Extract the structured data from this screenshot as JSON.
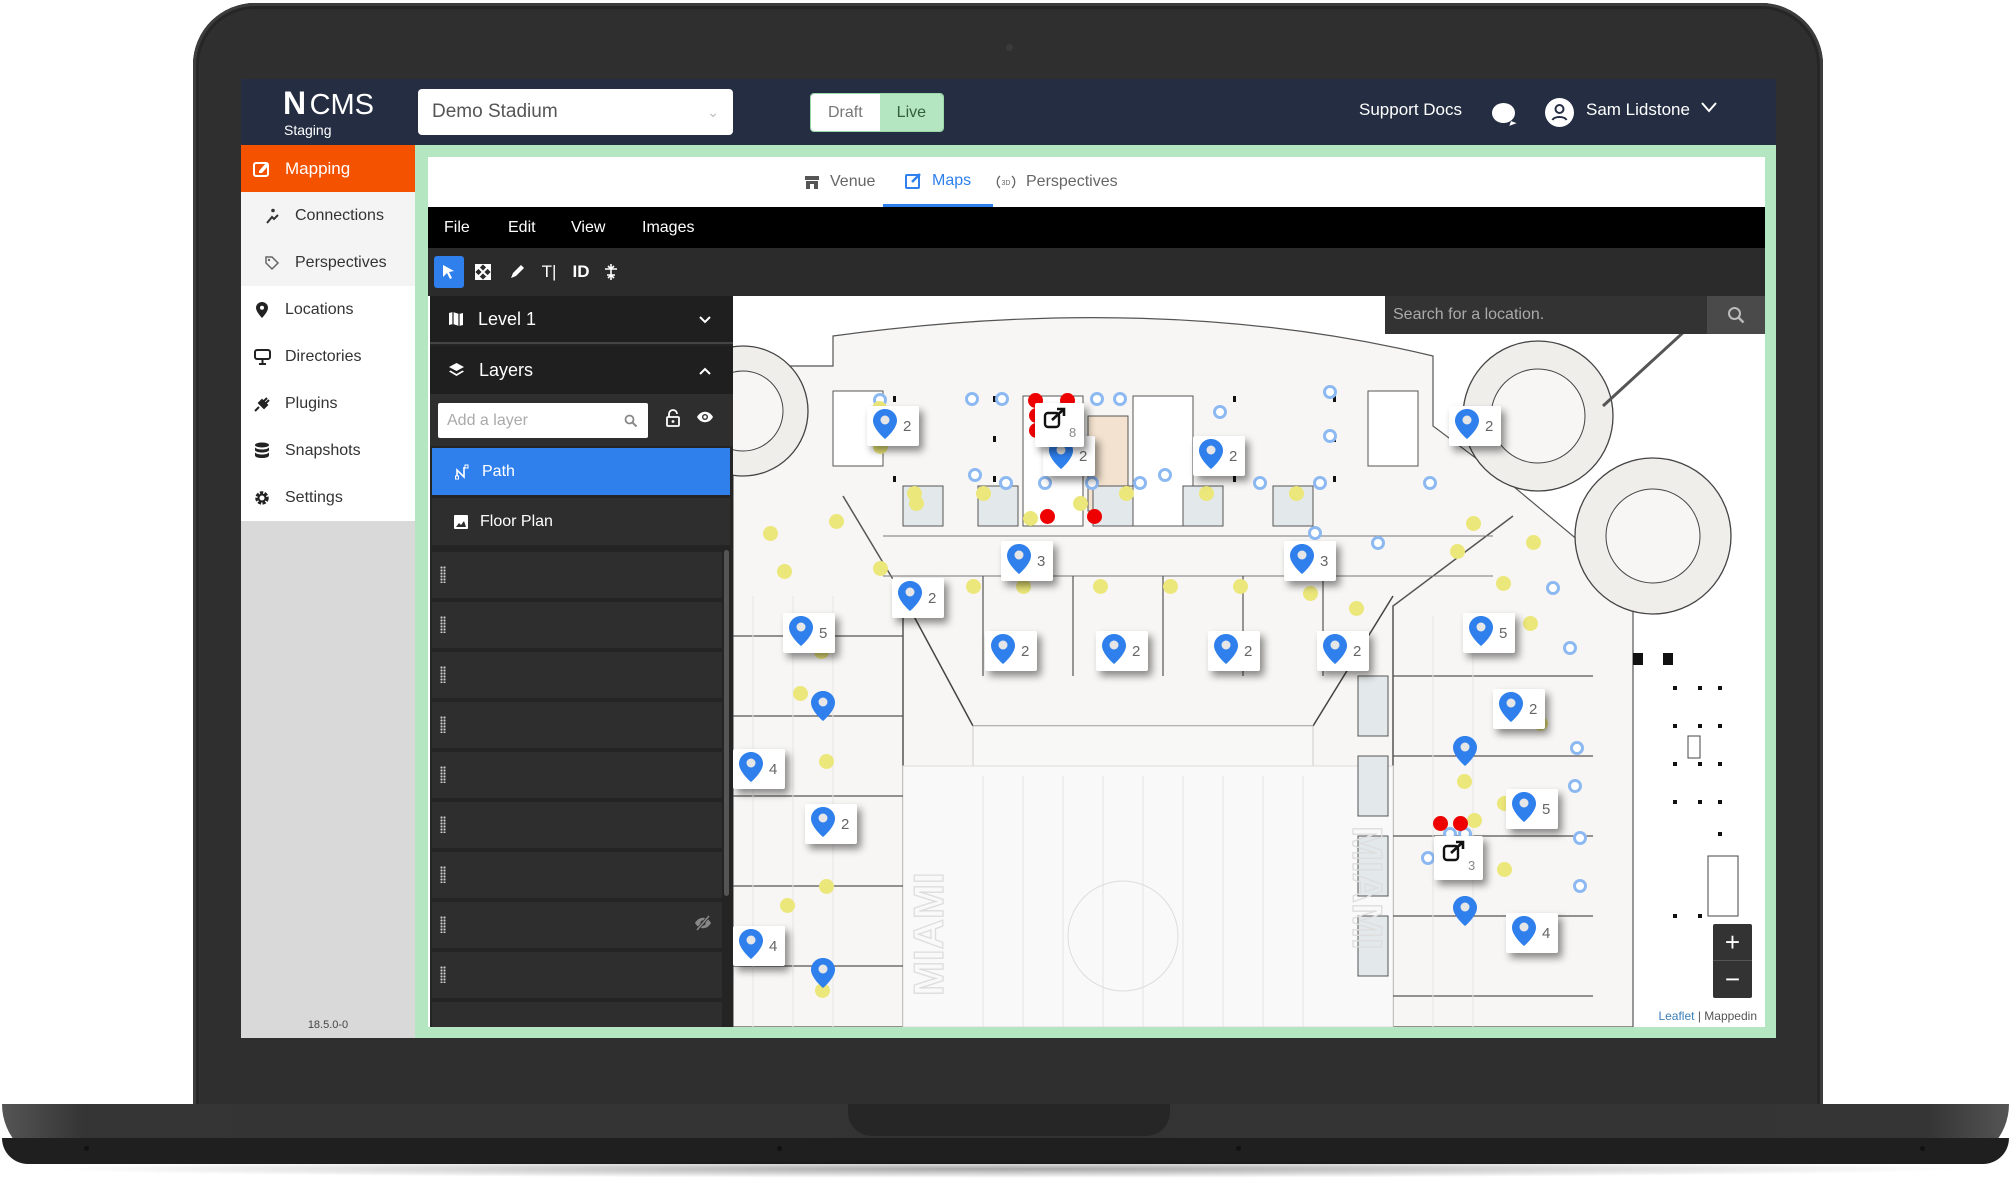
{
  "header": {
    "logo_mark": "N",
    "logo_text": "CMS",
    "environment": "Staging",
    "venue_select": {
      "value": "Demo Stadium"
    },
    "mode_toggle": {
      "options": [
        "Draft",
        "Live"
      ],
      "selected": "Live"
    },
    "support_link": "Support Docs",
    "user_name": "Sam Lidstone"
  },
  "sidebar": {
    "items": [
      {
        "label": "Mapping",
        "icon": "mapping-edit-icon",
        "active": true
      },
      {
        "label": "Connections",
        "icon": "escalator-icon",
        "sub": true
      },
      {
        "label": "Perspectives",
        "icon": "tag-icon",
        "sub": true
      },
      {
        "label": "Locations",
        "icon": "map-pin-icon"
      },
      {
        "label": "Directories",
        "icon": "kiosk-icon"
      },
      {
        "label": "Plugins",
        "icon": "plug-icon"
      },
      {
        "label": "Snapshots",
        "icon": "database-icon"
      },
      {
        "label": "Settings",
        "icon": "gear-icon"
      }
    ],
    "version": "18.5.0-0"
  },
  "tabs": [
    {
      "label": "Venue",
      "icon": "store-icon"
    },
    {
      "label": "Maps",
      "icon": "edit-icon",
      "active": true
    },
    {
      "label": "Perspectives",
      "icon": "3d-rotate-icon"
    }
  ],
  "menubar": [
    "File",
    "Edit",
    "View",
    "Images"
  ],
  "toolbar": [
    {
      "name": "select-tool",
      "glyph": "",
      "active": true
    },
    {
      "name": "expand-tool",
      "glyph": ""
    },
    {
      "name": "draw-tool",
      "glyph": ""
    },
    {
      "name": "text-tool",
      "glyph": "T|"
    },
    {
      "name": "id-tool",
      "glyph": "ID"
    },
    {
      "name": "node-tool",
      "glyph": ""
    }
  ],
  "left_panel": {
    "level": "Level 1",
    "layers_title": "Layers",
    "layer_search_placeholder": "Add a layer",
    "layers": [
      {
        "label": "Path",
        "selected": true
      },
      {
        "label": "Floor Plan"
      }
    ],
    "empty_layer_rows": 9,
    "hidden_row_index": 7
  },
  "map": {
    "search_placeholder": "Search for a location.",
    "zoom_in": "+",
    "zoom_out": "−",
    "attribution_leaflet": "Leaflet",
    "attribution_sep": " | ",
    "attribution_provider": "Mappedin",
    "field_text": "MIAMI",
    "location_clusters": [
      "2",
      "2",
      "2",
      "2",
      "3",
      "3",
      "2",
      "5",
      "2",
      "2",
      "2",
      "2",
      "5",
      "2",
      "4",
      "2",
      "5",
      "4",
      "4"
    ],
    "connection_clusters": [
      "8",
      "3"
    ],
    "colors": {
      "pin": "#2f80ed",
      "node": "#ece77a",
      "exit_node": "#e00000",
      "connection": "#8db9f2"
    }
  },
  "colors": {
    "header_bg": "#242d42",
    "accent_orange": "#f55200",
    "live_green": "#b3e6c1",
    "selection_blue": "#2f80ed"
  }
}
